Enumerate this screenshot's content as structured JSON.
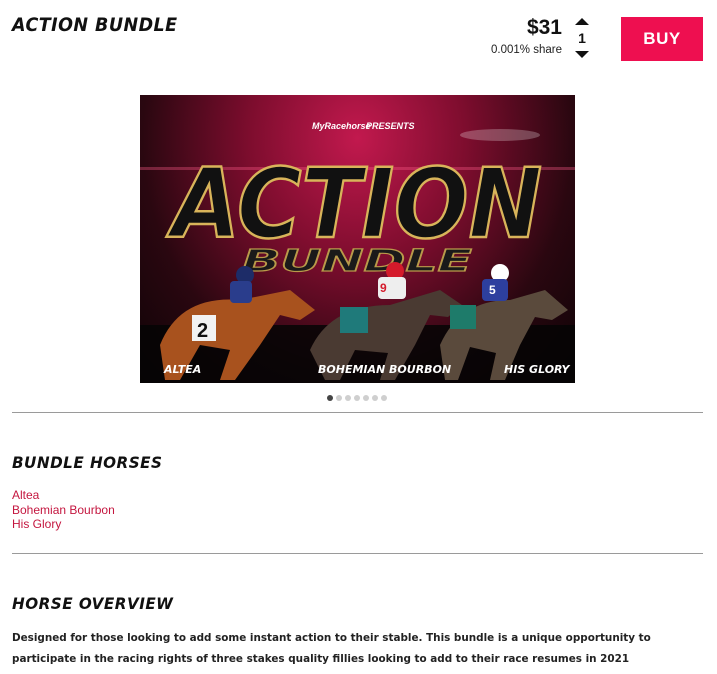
{
  "product": {
    "title": "ACTION BUNDLE",
    "price": "$31",
    "share": "0.001% share",
    "quantity": "1",
    "buy_label": "BUY",
    "brand_color": "#ee0f50"
  },
  "hero_image": {
    "brand": "MyRacehorse",
    "presents": "PRESENTS",
    "headline": "ACTION",
    "subline": "BUNDLE",
    "captions": [
      "ALTEA",
      "BOHEMIAN BOURBON",
      "HIS GLORY"
    ],
    "saddle_numbers": [
      "2",
      "9",
      "5"
    ],
    "slide_count": 7,
    "active_slide": 1
  },
  "bundle_horses": {
    "heading": "BUNDLE HORSES",
    "items": [
      "Altea",
      "Bohemian Bourbon",
      "His Glory"
    ],
    "link_color": "#c4163f"
  },
  "overview": {
    "heading": "HORSE OVERVIEW",
    "text": "Designed for those looking to add some instant action to their stable. This bundle is a unique opportunity to participate in the racing rights of three stakes quality fillies looking to add to their race resumes in 2021"
  },
  "icons": [
    "arrow-up-icon",
    "arrow-down-icon"
  ]
}
